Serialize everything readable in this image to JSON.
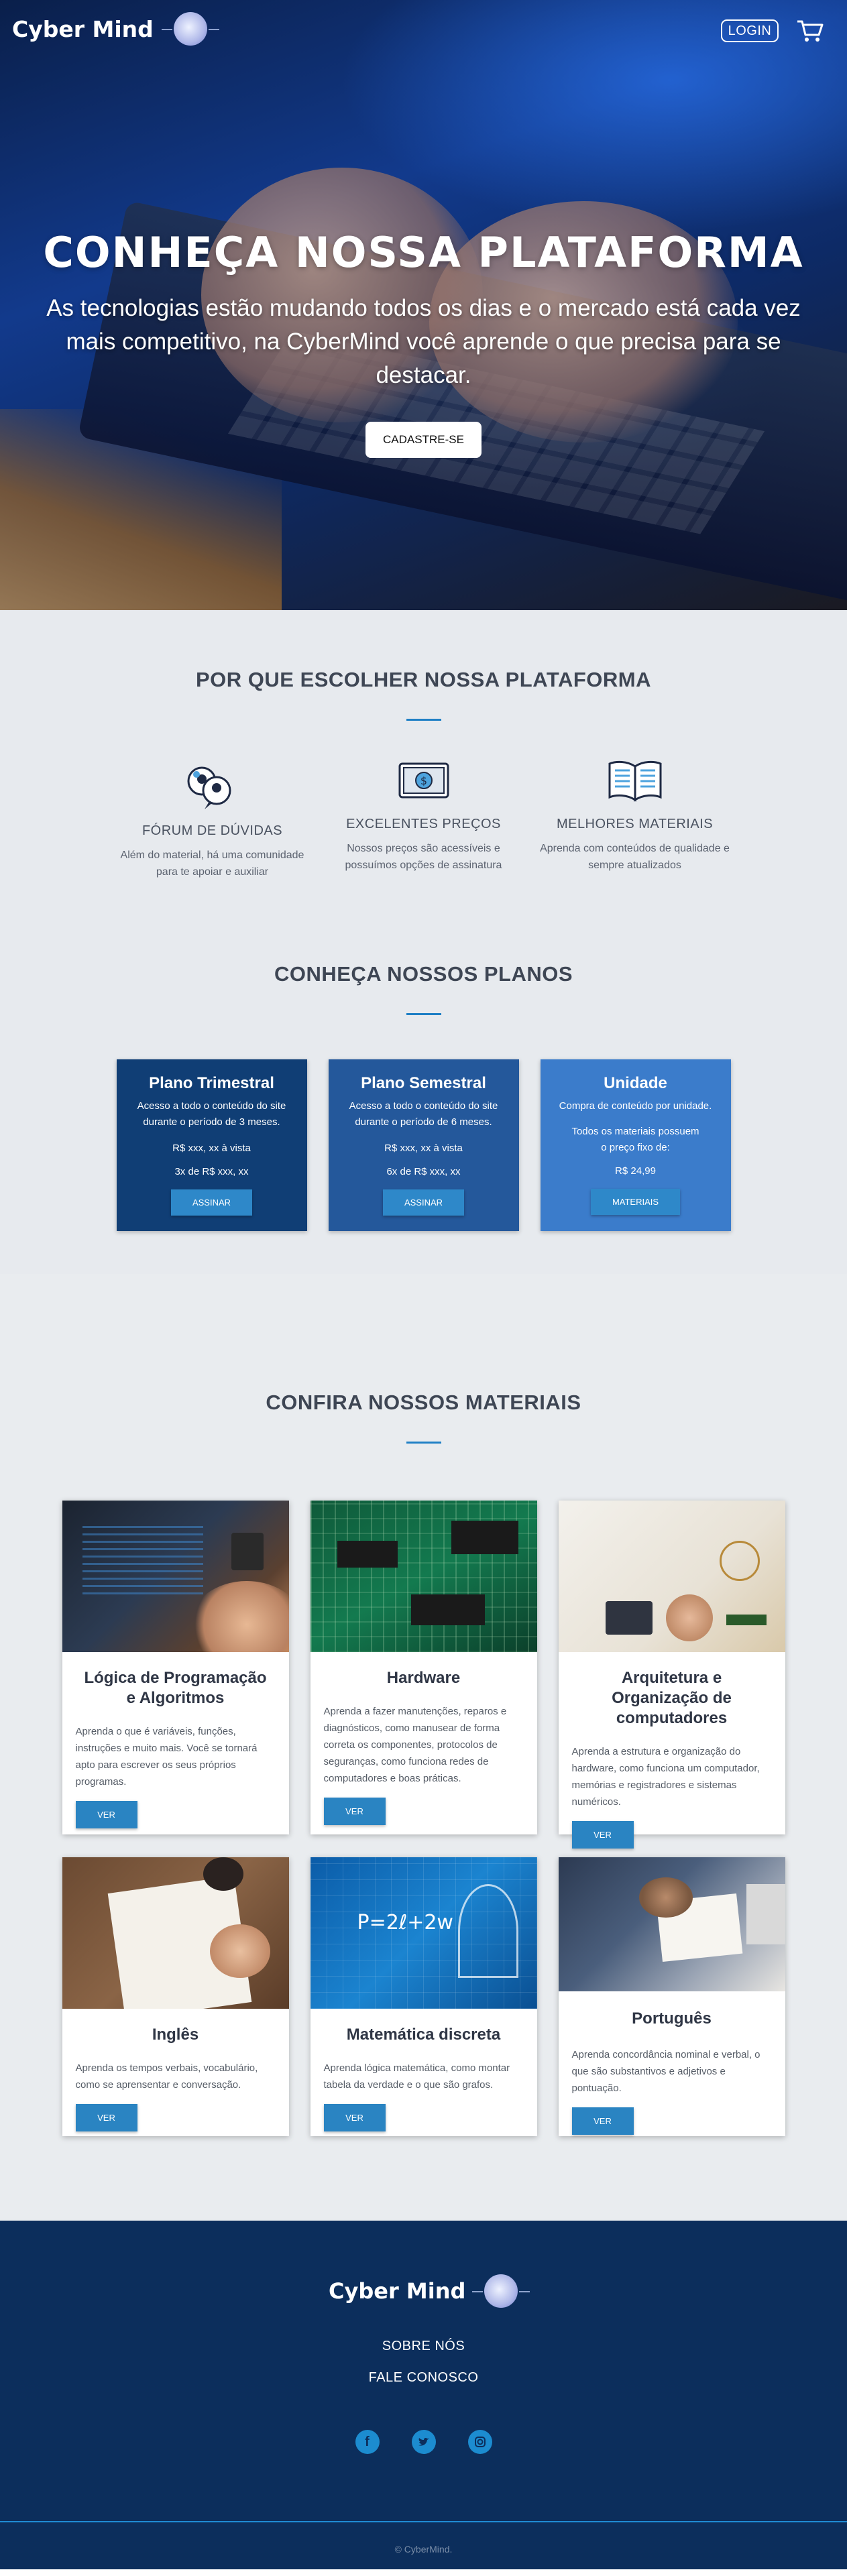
{
  "header": {
    "logo_text": "Cyber Mind",
    "login_label": "LOGIN",
    "cart_icon": "cart-icon"
  },
  "hero": {
    "title": "CONHEÇA NOSSA PLATAFORMA",
    "subtitle": "As tecnologias estão mudando todos os dias e o mercado está cada vez mais competitivo, na CyberMind você aprende o que precisa para se destacar.",
    "cta_label": "CADASTRE-SE"
  },
  "why": {
    "title": "POR QUE ESCOLHER NOSSA PLATAFORMA",
    "features": [
      {
        "icon": "chat-bubbles-icon",
        "title": "FÓRUM DE DÚVIDAS",
        "desc": "Além do material, há uma comunidade para te apoiar e auxiliar"
      },
      {
        "icon": "money-bill-icon",
        "title": "EXCELENTES PREÇOS",
        "desc": "Nossos preços são acessíveis e possuímos opções de assinatura"
      },
      {
        "icon": "book-icon",
        "title": "MELHORES MATERIAIS",
        "desc": "Aprenda com conteúdos de qualidade e sempre atualizados"
      }
    ]
  },
  "plans": {
    "title": "CONHEÇA NOSSOS PLANOS",
    "items": [
      {
        "name": "Plano Trimestral",
        "desc": "Acesso a todo o conteúdo do site durante o período de 3 meses.",
        "line1": "R$ xxx, xx à vista",
        "line2": "3x de R$ xxx, xx",
        "button": "ASSINAR",
        "color": "#103e75"
      },
      {
        "name": "Plano Semestral",
        "desc": "Acesso a todo o conteúdo do site durante o período de 6 meses.",
        "line1": "R$ xxx, xx à vista",
        "line2": "6x de R$ xxx, xx",
        "button": "ASSINAR",
        "color": "#24589b"
      },
      {
        "name": "Unidade",
        "desc": "Compra de conteúdo por unidade.",
        "line1": "Todos os materiais possuem o preço fixo de:",
        "line2": "R$ 24,99",
        "button": "MATERIAIS",
        "color": "#3b7ccb"
      }
    ]
  },
  "materials": {
    "title": "CONFIRA NOSSOS MATERIAIS",
    "items": [
      {
        "title": "Lógica de Programação e Algoritmos",
        "desc": "Aprenda o que é variáveis, funções, instruções e muito mais. Você se tornará apto para escrever os seus próprios programas.",
        "button": "VER"
      },
      {
        "title": "Hardware",
        "desc": "Aprenda a fazer manutenções, reparos e diagnósticos, como manusear de forma correta os componentes, protocolos de seguranças, como funciona redes de computadores e boas práticas.",
        "button": "VER"
      },
      {
        "title": "Arquitetura e Organização de computadores",
        "desc": "Aprenda a estrutura e organização do hardware, como funciona um computador, memórias e registradores e sistemas numéricos.",
        "button": "VER"
      },
      {
        "title": "Inglês",
        "desc": "Aprenda os tempos verbais, vocabulário, como se aprensentar e conversação.",
        "button": "VER"
      },
      {
        "title": "Matemática discreta",
        "desc": "Aprenda lógica matemática, como montar tabela da verdade e o que são grafos.",
        "button": "VER",
        "image_text": "P=2ℓ+2w"
      },
      {
        "title": "Português",
        "desc": "Aprenda concordância nominal e verbal, o que são substantivos e adjetivos e pontuação.",
        "button": "VER"
      }
    ]
  },
  "footer": {
    "logo_text": "Cyber Mind",
    "links": [
      "SOBRE NÓS",
      "FALE CONOSCO"
    ],
    "social": [
      "facebook-icon",
      "twitter-icon",
      "instagram-icon"
    ],
    "copyright": "© CyberMind."
  }
}
